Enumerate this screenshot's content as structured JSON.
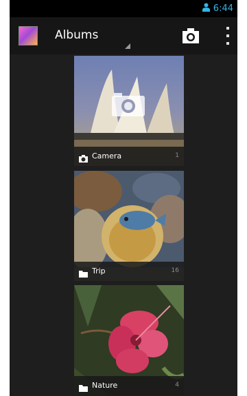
{
  "status_bar": {
    "time": "6:44",
    "icons": [
      "person-notification-icon"
    ]
  },
  "action_bar": {
    "app_icon": "gallery-app-icon",
    "spinner_label": "Albums",
    "camera_icon": "camera-icon",
    "overflow_icon": "overflow-menu-icon"
  },
  "albums": [
    {
      "name": "Camera",
      "count": "1",
      "type_icon": "camera-icon"
    },
    {
      "name": "Trip",
      "count": "16",
      "type_icon": "folder-icon"
    },
    {
      "name": "Nature",
      "count": "4",
      "type_icon": "folder-icon"
    }
  ],
  "colors": {
    "status_accent": "#33b5e5",
    "background": "#1e1e1e",
    "actionbar": "#161616"
  }
}
